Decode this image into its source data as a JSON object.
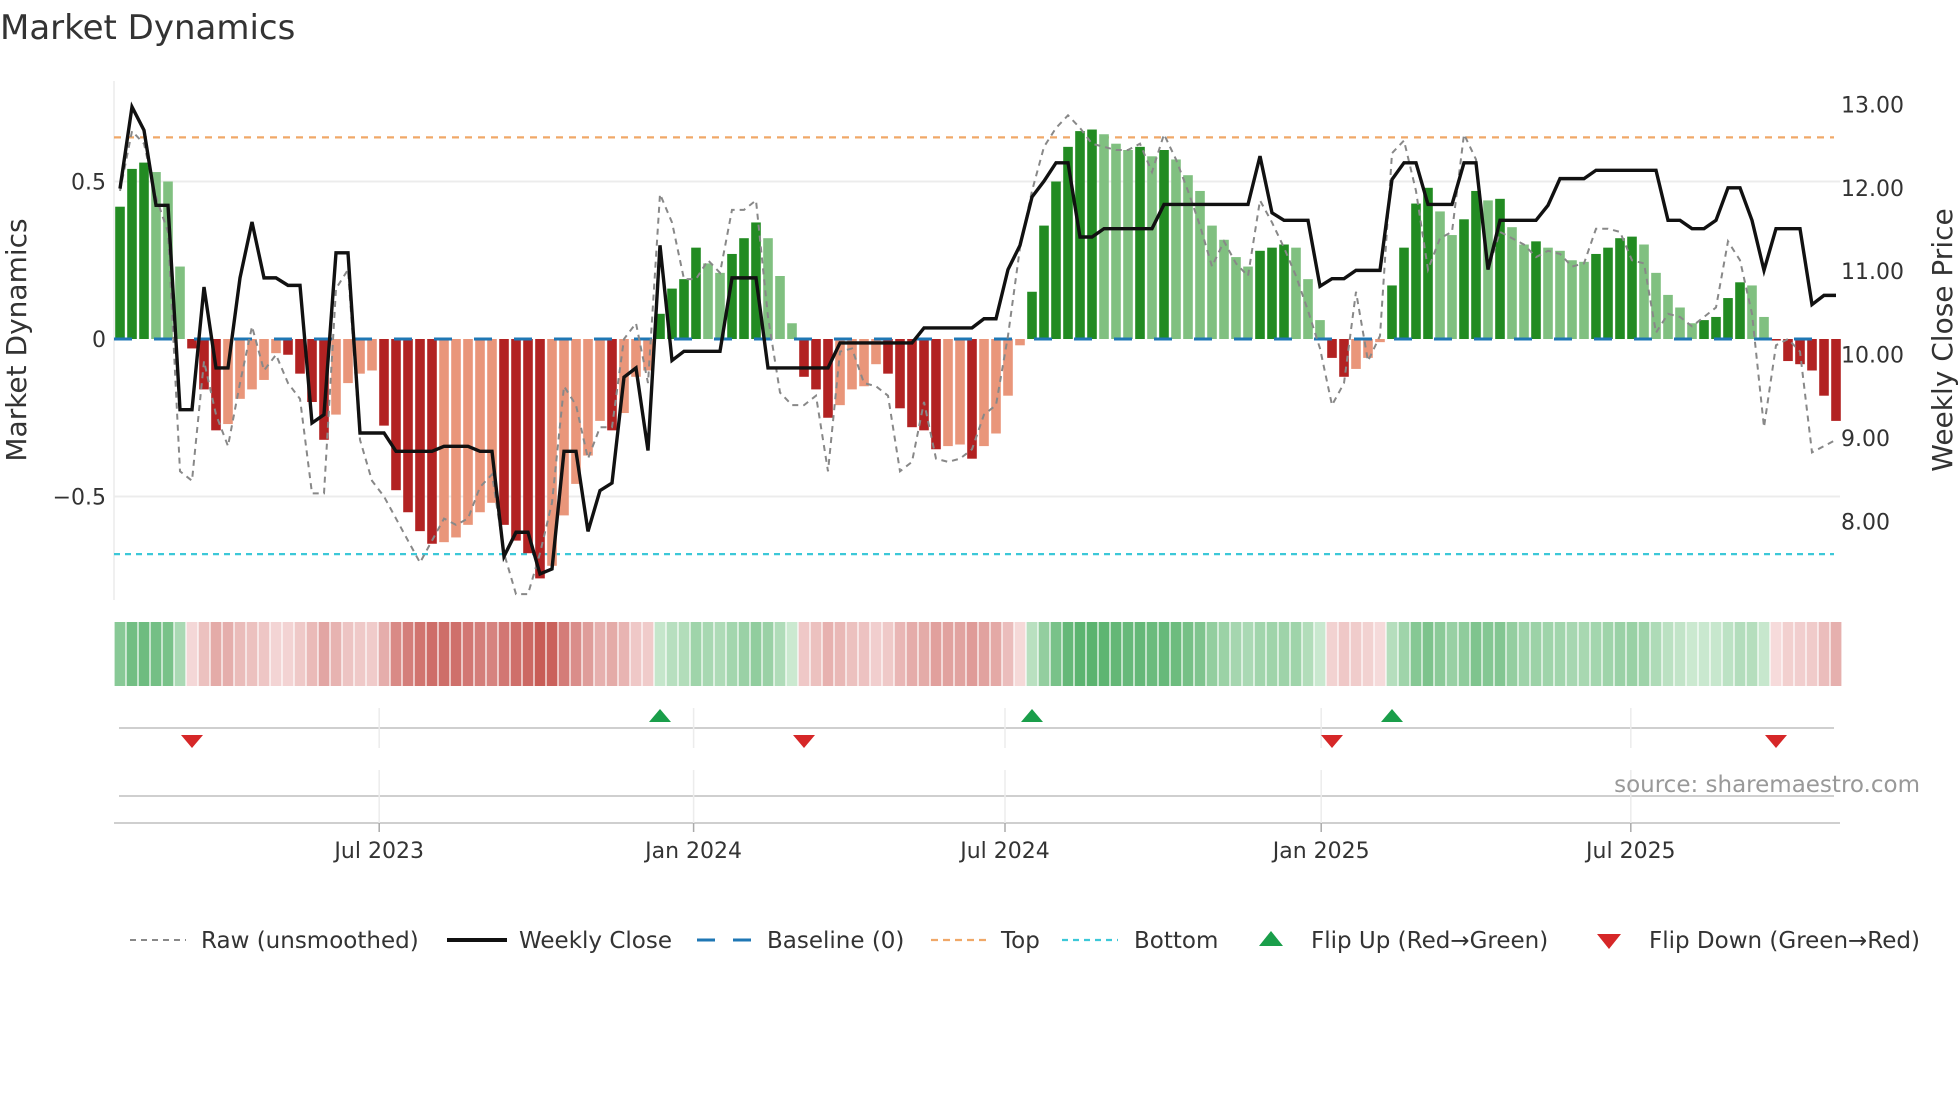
{
  "chart_data": {
    "type": "bar",
    "title": "Market Dynamics",
    "ylabel": "Market Dynamics",
    "y2label": "Weekly Close Price",
    "ylim": [
      -0.83,
      0.84
    ],
    "y2lim": [
      6.6,
      13.3
    ],
    "yticks": [
      {
        "value": 0.5,
        "label": "0.5"
      },
      {
        "value": 0,
        "label": "0"
      },
      {
        "value": -0.5,
        "label": "−0.5"
      }
    ],
    "y2ticks": [
      {
        "value": 13,
        "label": "13.00"
      },
      {
        "value": 12,
        "label": "12.00"
      },
      {
        "value": 11,
        "label": "11.00"
      },
      {
        "value": 10,
        "label": "10.00"
      },
      {
        "value": 9,
        "label": "9.00"
      },
      {
        "value": 8,
        "label": "8.00"
      }
    ],
    "xticks": [
      {
        "week": 21.6,
        "label": "Jul 2023"
      },
      {
        "week": 47.8,
        "label": "Jan 2024"
      },
      {
        "week": 73.75,
        "label": "Jul 2024"
      },
      {
        "week": 100.1,
        "label": "Jan 2025"
      },
      {
        "week": 125.9,
        "label": "Jul 2025"
      }
    ],
    "top_level": 0.64,
    "bottom_level": -0.683,
    "baseline": 0,
    "grid": true,
    "legend_position": "bottom",
    "dynamics": [
      0.42,
      0.54,
      0.56,
      0.53,
      0.5,
      0.23,
      -0.03,
      -0.16,
      -0.29,
      -0.27,
      -0.19,
      -0.16,
      -0.13,
      -0.045,
      -0.05,
      -0.11,
      -0.2,
      -0.32,
      -0.24,
      -0.14,
      -0.11,
      -0.1,
      -0.275,
      -0.48,
      -0.55,
      -0.61,
      -0.65,
      -0.645,
      -0.63,
      -0.59,
      -0.55,
      -0.52,
      -0.59,
      -0.64,
      -0.68,
      -0.76,
      -0.72,
      -0.56,
      -0.46,
      -0.37,
      -0.26,
      -0.29,
      -0.235,
      -0.12,
      -0.1,
      0.08,
      0.16,
      0.19,
      0.29,
      0.24,
      0.21,
      0.27,
      0.32,
      0.37,
      0.32,
      0.2,
      0.05,
      -0.12,
      -0.16,
      -0.25,
      -0.21,
      -0.16,
      -0.15,
      -0.08,
      -0.11,
      -0.22,
      -0.28,
      -0.29,
      -0.35,
      -0.34,
      -0.335,
      -0.38,
      -0.34,
      -0.3,
      -0.18,
      -0.02,
      0.15,
      0.36,
      0.5,
      0.61,
      0.66,
      0.665,
      0.65,
      0.62,
      0.6,
      0.61,
      0.58,
      0.6,
      0.57,
      0.52,
      0.47,
      0.36,
      0.315,
      0.26,
      0.23,
      0.28,
      0.29,
      0.3,
      0.29,
      0.19,
      0.06,
      -0.06,
      -0.12,
      -0.095,
      -0.06,
      -0.01,
      0.17,
      0.29,
      0.43,
      0.48,
      0.405,
      0.33,
      0.38,
      0.47,
      0.44,
      0.445,
      0.355,
      0.3,
      0.31,
      0.29,
      0.28,
      0.25,
      0.245,
      0.27,
      0.29,
      0.32,
      0.325,
      0.3,
      0.21,
      0.14,
      0.1,
      0.05,
      0.06,
      0.07,
      0.13,
      0.18,
      0.17,
      0.07,
      -0.005,
      -0.07,
      -0.08,
      -0.1,
      -0.18,
      -0.26
    ],
    "raw": [
      0.47,
      0.66,
      0.62,
      0.45,
      0.34,
      -0.42,
      -0.45,
      -0.07,
      -0.24,
      -0.34,
      -0.14,
      0.04,
      -0.1,
      -0.05,
      -0.14,
      -0.19,
      -0.49,
      -0.49,
      0.16,
      0.22,
      -0.32,
      -0.45,
      -0.5,
      -0.57,
      -0.64,
      -0.71,
      -0.64,
      -0.57,
      -0.59,
      -0.57,
      -0.47,
      -0.43,
      -0.68,
      -0.81,
      -0.81,
      -0.68,
      -0.52,
      -0.15,
      -0.21,
      -0.38,
      -0.28,
      -0.28,
      0.0,
      0.05,
      -0.14,
      0.46,
      0.37,
      0.19,
      0.19,
      0.25,
      0.21,
      0.41,
      0.41,
      0.44,
      0.07,
      -0.17,
      -0.21,
      -0.21,
      -0.18,
      -0.42,
      -0.04,
      -0.03,
      -0.14,
      -0.15,
      -0.18,
      -0.42,
      -0.39,
      -0.2,
      -0.38,
      -0.39,
      -0.38,
      -0.35,
      -0.24,
      -0.21,
      0.01,
      0.29,
      0.47,
      0.61,
      0.67,
      0.71,
      0.67,
      0.62,
      0.61,
      0.6,
      0.6,
      0.62,
      0.53,
      0.65,
      0.57,
      0.47,
      0.36,
      0.23,
      0.31,
      0.24,
      0.2,
      0.44,
      0.37,
      0.29,
      0.2,
      0.09,
      -0.03,
      -0.21,
      -0.14,
      0.15,
      -0.07,
      0.01,
      0.59,
      0.63,
      0.47,
      0.22,
      0.32,
      0.34,
      0.65,
      0.57,
      0.22,
      0.34,
      0.32,
      0.3,
      0.26,
      0.28,
      0.27,
      0.23,
      0.24,
      0.35,
      0.35,
      0.34,
      0.25,
      0.24,
      0.02,
      0.08,
      0.07,
      0.04,
      0.07,
      0.1,
      0.31,
      0.25,
      0.08,
      -0.28,
      -0.02,
      0.0,
      -0.04,
      -0.36,
      -0.34,
      -0.32
    ],
    "close": [
      11.99,
      12.97,
      12.69,
      11.79,
      11.79,
      9.34,
      9.34,
      10.81,
      9.84,
      9.84,
      10.92,
      11.59,
      10.92,
      10.92,
      10.83,
      10.83,
      9.18,
      9.28,
      11.22,
      11.22,
      9.06,
      9.06,
      9.06,
      8.84,
      8.84,
      8.84,
      8.84,
      8.9,
      8.9,
      8.9,
      8.84,
      8.84,
      7.58,
      7.87,
      7.87,
      7.37,
      7.43,
      8.84,
      8.84,
      7.88,
      8.37,
      8.46,
      9.73,
      9.84,
      8.85,
      11.31,
      9.93,
      10.04,
      10.04,
      10.04,
      10.04,
      10.92,
      10.92,
      10.92,
      9.84,
      9.84,
      9.84,
      9.84,
      9.84,
      9.84,
      10.14,
      10.14,
      10.14,
      10.14,
      10.14,
      10.14,
      10.14,
      10.32,
      10.32,
      10.32,
      10.32,
      10.32,
      10.43,
      10.43,
      11.02,
      11.31,
      11.89,
      12.08,
      12.3,
      12.3,
      11.41,
      11.41,
      11.51,
      11.51,
      11.51,
      11.51,
      11.51,
      11.8,
      11.8,
      11.8,
      11.8,
      11.8,
      11.8,
      11.8,
      11.8,
      12.38,
      11.7,
      11.61,
      11.61,
      11.61,
      10.82,
      10.91,
      10.91,
      11.01,
      11.01,
      11.01,
      12.1,
      12.3,
      12.3,
      11.8,
      11.8,
      11.8,
      12.3,
      12.3,
      11.02,
      11.61,
      11.61,
      11.61,
      11.61,
      11.79,
      12.11,
      12.11,
      12.11,
      12.21,
      12.21,
      12.21,
      12.21,
      12.21,
      12.21,
      11.61,
      11.61,
      11.51,
      11.51,
      11.61,
      12.0,
      12.0,
      11.61,
      11.01,
      11.51,
      11.51,
      11.51,
      10.6,
      10.71,
      10.71
    ],
    "flips": [
      {
        "week": 6,
        "type": "down"
      },
      {
        "week": 45,
        "type": "up"
      },
      {
        "week": 57,
        "type": "down"
      },
      {
        "week": 76,
        "type": "up"
      },
      {
        "week": 101,
        "type": "down"
      },
      {
        "week": 106,
        "type": "up"
      },
      {
        "week": 138,
        "type": "down"
      }
    ],
    "colors": {
      "green_strong": "#228b22",
      "green_weak": "#80c080",
      "red_strong": "#b22222",
      "red_weak": "#e9967a",
      "close": "#111111",
      "raw": "#888888",
      "baseline": "#1f77b4",
      "top": "#f0a868",
      "bottom": "#3cc8d8",
      "flip_up": "#1a9e4a",
      "flip_down": "#d62728"
    },
    "legend": [
      {
        "key": "raw",
        "label": "Raw (unsmoothed)"
      },
      {
        "key": "close",
        "label": "Weekly Close"
      },
      {
        "key": "baseline",
        "label": "Baseline (0)"
      },
      {
        "key": "top",
        "label": "Top"
      },
      {
        "key": "bottom",
        "label": "Bottom"
      },
      {
        "key": "flip_up",
        "label": "Flip Up (Red→Green)"
      },
      {
        "key": "flip_down",
        "label": "Flip Down (Green→Red)"
      }
    ],
    "source": "source: sharemaestro.com"
  }
}
